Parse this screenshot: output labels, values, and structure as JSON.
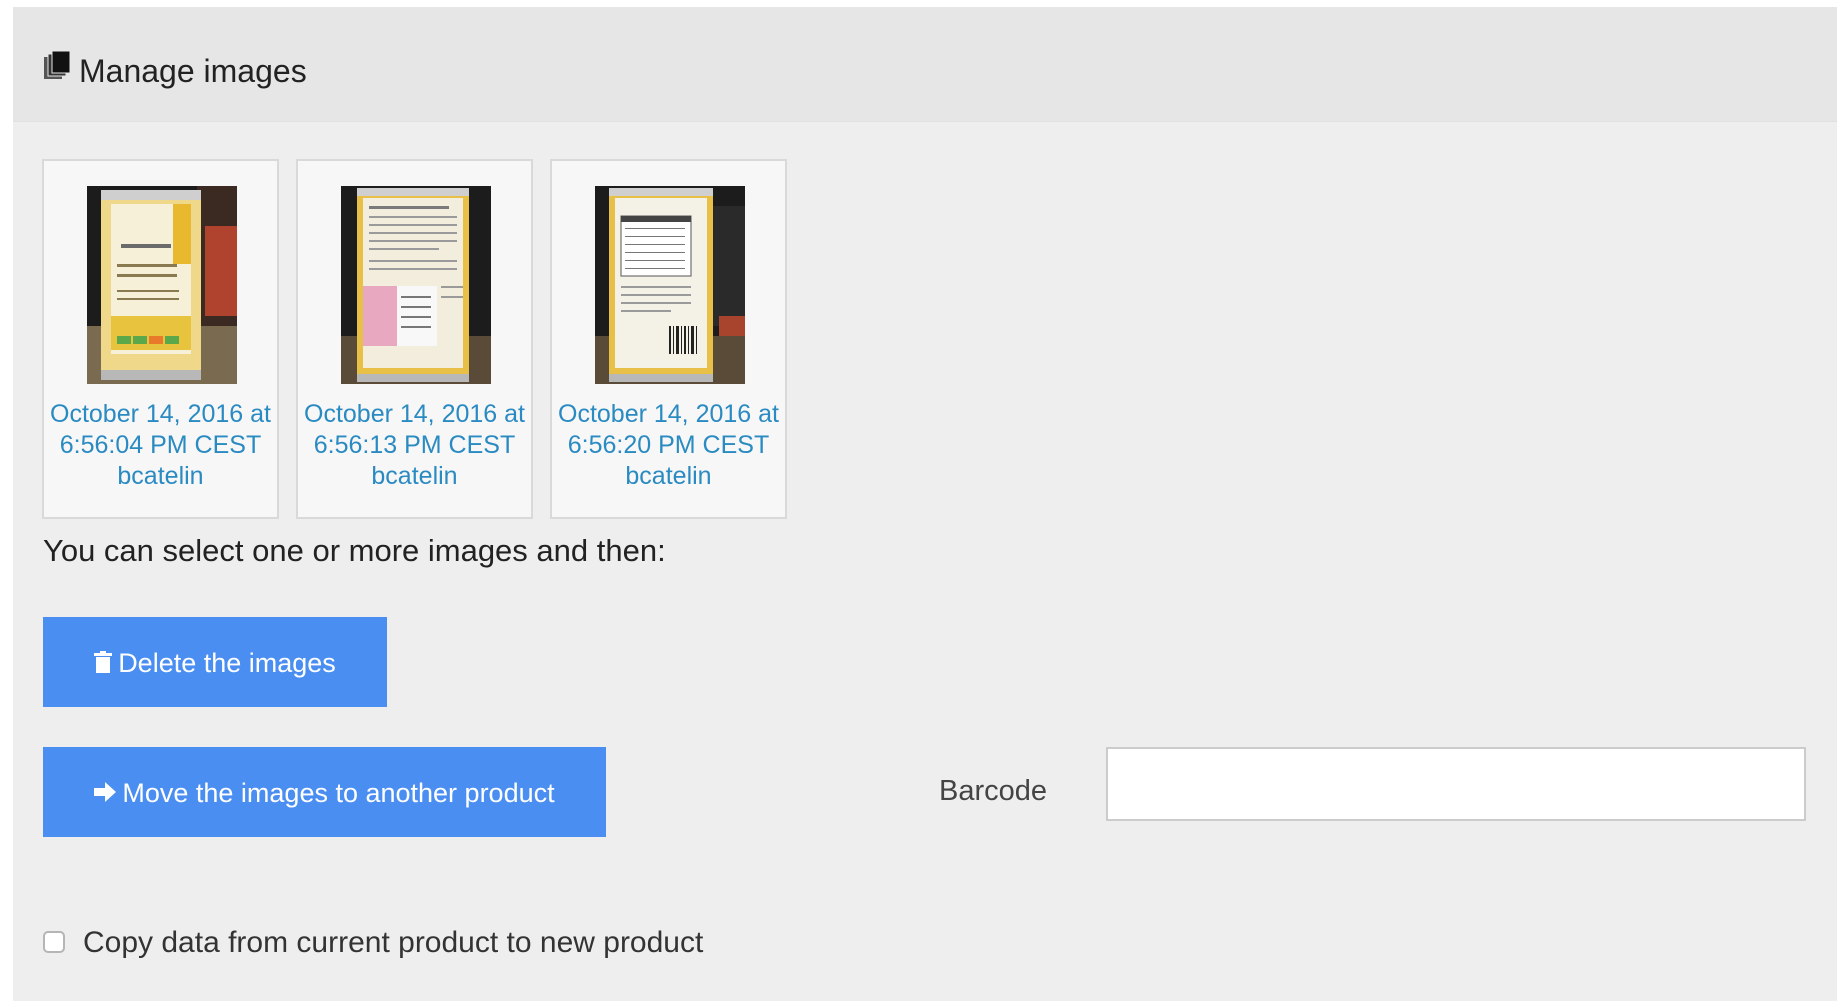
{
  "header": {
    "icon": "images-icon",
    "title": "Manage images"
  },
  "images": [
    {
      "date_line1": "October 14, 2016 at",
      "date_line2": "6:56:04 PM CEST",
      "user": "bcatelin"
    },
    {
      "date_line1": "October 14, 2016 at",
      "date_line2": "6:56:13 PM CEST",
      "user": "bcatelin"
    },
    {
      "date_line1": "October 14, 2016 at",
      "date_line2": "6:56:20 PM CEST",
      "user": "bcatelin"
    }
  ],
  "instructions": "You can select one or more images and then:",
  "actions": {
    "delete_label": "Delete the images",
    "delete_icon": "trash-icon",
    "move_label": "Move the images to another product",
    "move_icon": "arrow-right-icon"
  },
  "barcode": {
    "label": "Barcode",
    "value": "",
    "placeholder": ""
  },
  "copy_option": {
    "label": "Copy data from current product to new product",
    "checked": false
  },
  "colors": {
    "button_bg": "#4a8ef2",
    "link": "#2a8ac2",
    "panel_bg": "#eeeeee",
    "header_bg": "#e6e6e6"
  }
}
